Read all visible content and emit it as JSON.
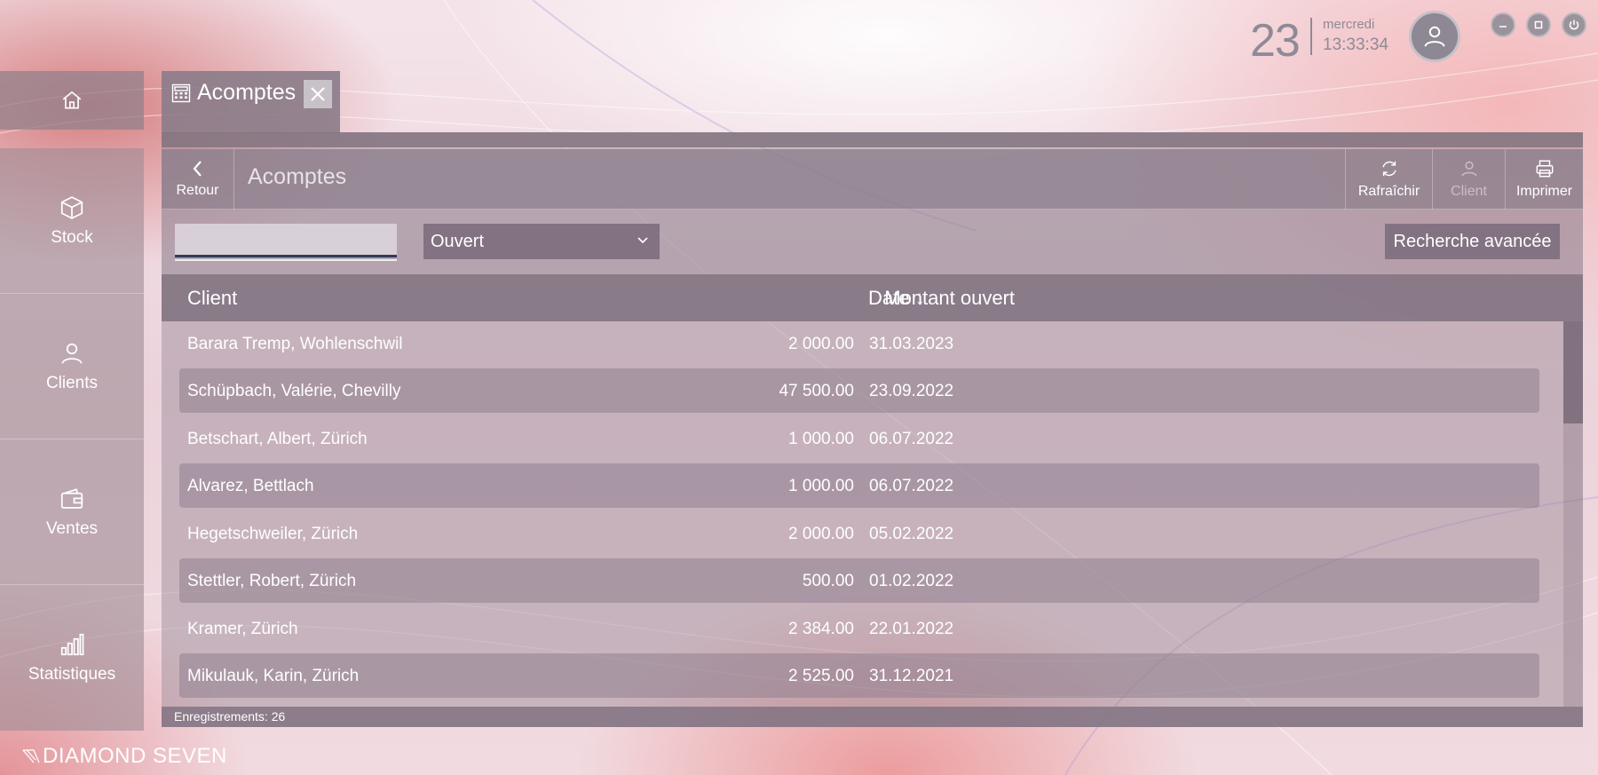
{
  "header": {
    "day": "23",
    "weekday": "mercredi",
    "time": "13:33:34"
  },
  "sidebar": {
    "items": [
      {
        "label": "Stock",
        "icon": "box-icon"
      },
      {
        "label": "Clients",
        "icon": "person-icon"
      },
      {
        "label": "Ventes",
        "icon": "wallet-icon"
      },
      {
        "label": "Statistiques",
        "icon": "bar-chart-icon"
      }
    ]
  },
  "tab": {
    "label": "Acomptes"
  },
  "toolbar": {
    "back_label": "Retour",
    "title": "Acomptes",
    "refresh_label": "Rafraîchir",
    "client_label": "Client",
    "print_label": "Imprimer"
  },
  "filters": {
    "search_value": "",
    "status_selected": "Ouvert",
    "advanced_search_label": "Recherche avancée"
  },
  "table": {
    "columns": {
      "client": "Client",
      "amount": "Montant ouvert",
      "date": "Date"
    },
    "sort_indicator": "↓",
    "rows": [
      {
        "client": "Barara Tremp, Wohlenschwil",
        "amount": "2 000.00",
        "date": "31.03.2023"
      },
      {
        "client": "Schüpbach, Valérie, Chevilly",
        "amount": "47 500.00",
        "date": "23.09.2022"
      },
      {
        "client": "Betschart, Albert, Zürich",
        "amount": "1 000.00",
        "date": "06.07.2022"
      },
      {
        "client": "Alvarez, Bettlach",
        "amount": "1 000.00",
        "date": "06.07.2022"
      },
      {
        "client": "Hegetschweiler, Zürich",
        "amount": "2 000.00",
        "date": "05.02.2022"
      },
      {
        "client": "Stettler, Robert, Zürich",
        "amount": "500.00",
        "date": "01.02.2022"
      },
      {
        "client": "Kramer, Zürich",
        "amount": "2 384.00",
        "date": "22.01.2022"
      },
      {
        "client": "Mikulauk, Karin, Zürich",
        "amount": "2 525.00",
        "date": "31.12.2021"
      }
    ]
  },
  "footer": {
    "records": "Enregistrements: 26"
  },
  "brand": {
    "name": "DIAMOND SEVEN"
  }
}
